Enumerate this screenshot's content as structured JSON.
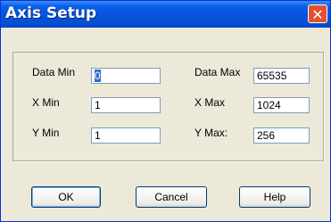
{
  "window": {
    "title": "Axis Setup",
    "close_glyph": "✕"
  },
  "fields": {
    "data_min": {
      "label": "Data Min",
      "value": "0"
    },
    "x_min": {
      "label": "X Min",
      "value": "1"
    },
    "y_min": {
      "label": "Y Min",
      "value": "1"
    },
    "data_max": {
      "label": "Data Max",
      "value": "65535"
    },
    "x_max": {
      "label": "X Max",
      "value": "1024"
    },
    "y_max": {
      "label": "Y Max:",
      "value": "256"
    }
  },
  "buttons": {
    "ok": "OK",
    "cancel": "Cancel",
    "help": "Help"
  }
}
